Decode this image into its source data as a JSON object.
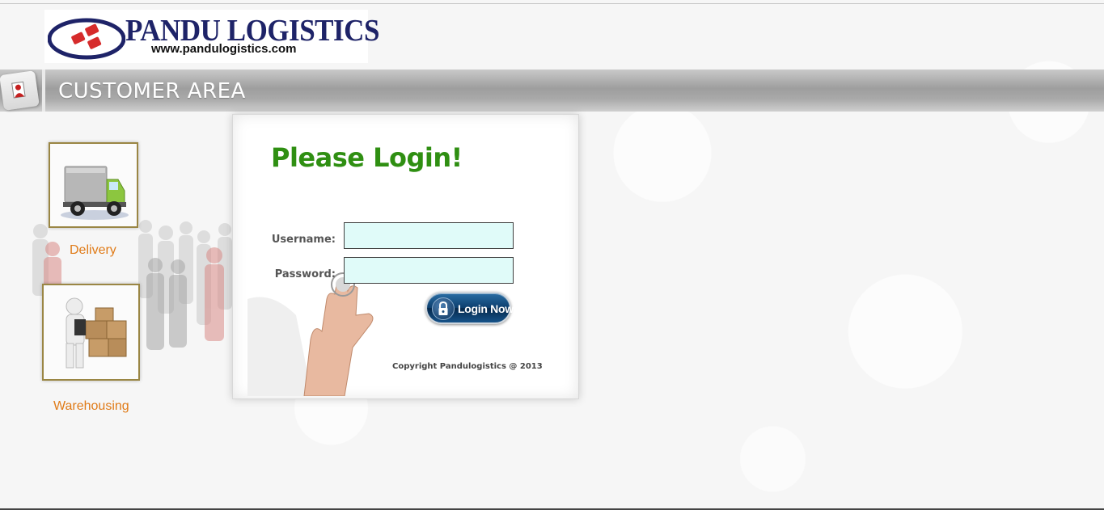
{
  "brand": {
    "name": "PANDU LOGISTICS",
    "url": "www.pandulogistics.com",
    "colors": {
      "navy": "#1e2368",
      "red": "#d62b2b",
      "green": "#2f8f12",
      "orange": "#e07b18",
      "field_bg": "#e0fbf9"
    }
  },
  "header": {
    "title": "CUSTOMER AREA",
    "icon": "customer-area-icon"
  },
  "nav": {
    "items": [
      {
        "label": "Delivery",
        "icon": "delivery-truck-icon"
      },
      {
        "label": "Warehousing",
        "icon": "warehouse-boxes-icon"
      }
    ]
  },
  "login": {
    "title": "Please Login!",
    "username_label": "Username:",
    "username_value": "",
    "password_label": "Password:",
    "password_value": "",
    "button_label": "Login Now",
    "button_icon": "lock-icon",
    "copyright": "Copyright Pandulogistics @ 2013"
  }
}
